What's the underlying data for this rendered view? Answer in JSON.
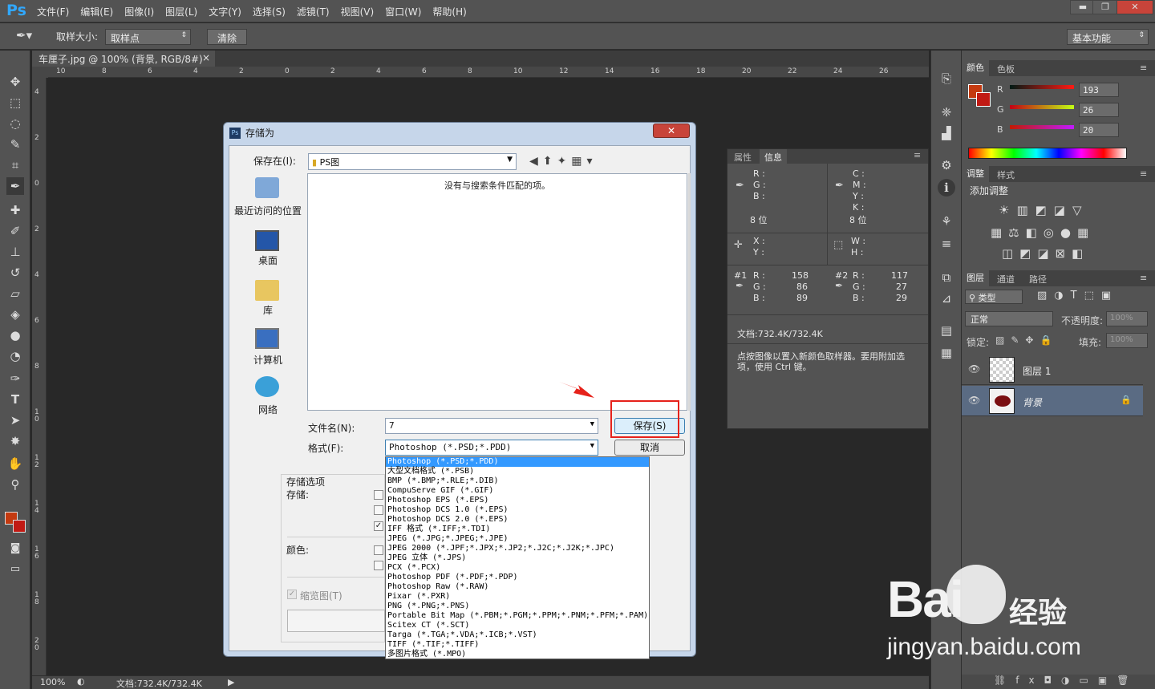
{
  "app": {
    "logo": "Ps",
    "menu": [
      "文件(F)",
      "编辑(E)",
      "图像(I)",
      "图层(L)",
      "文字(Y)",
      "选择(S)",
      "滤镜(T)",
      "视图(V)",
      "窗口(W)",
      "帮助(H)"
    ],
    "window_controls": [
      "▬",
      "❐",
      "✕"
    ]
  },
  "options": {
    "sample_size_label": "取样大小:",
    "sample_size_value": "取样点",
    "clear_label": "清除",
    "workspace": "基本功能"
  },
  "document": {
    "tab_title": "车厘子.jpg @ 100% (背景, RGB/8#) *",
    "tab_close": "×",
    "ruler_h": [
      "10",
      "8",
      "6",
      "4",
      "2",
      "0",
      "2",
      "4",
      "6",
      "8",
      "10",
      "12",
      "14",
      "16",
      "18",
      "20",
      "22",
      "24",
      "26"
    ],
    "ruler_v": [
      "4",
      "2",
      "0",
      "2",
      "4",
      "6",
      "8",
      "1 0",
      "1 2",
      "1 4",
      "1 6",
      "1 8",
      "2 0"
    ],
    "zoom": "100%",
    "doc_size": "文档:732.4K/732.4K"
  },
  "info_panel": {
    "tabs": [
      "属性",
      "信息"
    ],
    "rgb_labels": [
      "R :",
      "G :",
      "B :"
    ],
    "cmyk_labels": [
      "C :",
      "M :",
      "Y :",
      "K :"
    ],
    "bits_left": "8 位",
    "bits_right": "8 位",
    "xy_labels": [
      "X :",
      "Y :"
    ],
    "wh_labels": [
      "W :",
      "H :"
    ],
    "sample1_label": "#1",
    "sample1": {
      "R": "158",
      "G": "86",
      "B": "89"
    },
    "sample2_label": "#2",
    "sample2": {
      "R": "117",
      "G": "27",
      "B": "29"
    },
    "doc": "文档:732.4K/732.4K",
    "hint": "点按图像以置入新颜色取样器。要用附加选项，使用 Ctrl 键。"
  },
  "color_panel": {
    "tabs": [
      "颜色",
      "色板"
    ],
    "labels": [
      "R",
      "G",
      "B"
    ],
    "values": [
      "193",
      "26",
      "20"
    ],
    "fg_color": "#c11a14"
  },
  "adjust_panel": {
    "tabs": [
      "调整",
      "样式"
    ],
    "title": "添加调整"
  },
  "layers_panel": {
    "tabs": [
      "图层",
      "通道",
      "路径"
    ],
    "filter": "类型",
    "blend": "正常",
    "opacity_label": "不透明度:",
    "opacity": "100%",
    "lock_label": "锁定:",
    "fill_label": "填充:",
    "fill": "100%",
    "layers": [
      "图层 1",
      "背景"
    ]
  },
  "dialog": {
    "title": "存储为",
    "close": "✕",
    "save_in_label": "保存在(I):",
    "folder": "PS图",
    "empty_msg": "没有与搜索条件匹配的项。",
    "places": [
      "最近访问的位置",
      "桌面",
      "库",
      "计算机",
      "网络"
    ],
    "filename_label": "文件名(N):",
    "filename": "7",
    "format_label": "格式(F):",
    "format_value": "Photoshop (*.PSD;*.PDD)",
    "save_button": "保存(S)",
    "cancel_button": "取消",
    "options_title": "存储选项",
    "save_label": "存储:",
    "color_label": "颜色:",
    "thumbnail_label": "缩览图(T)",
    "formats": [
      "Photoshop (*.PSD;*.PDD)",
      "大型文档格式 (*.PSB)",
      "BMP (*.BMP;*.RLE;*.DIB)",
      "CompuServe GIF (*.GIF)",
      "Photoshop EPS (*.EPS)",
      "Photoshop DCS 1.0 (*.EPS)",
      "Photoshop DCS 2.0 (*.EPS)",
      "IFF 格式 (*.IFF;*.TDI)",
      "JPEG (*.JPG;*.JPEG;*.JPE)",
      "JPEG 2000 (*.JPF;*.JPX;*.JP2;*.J2C;*.J2K;*.JPC)",
      "JPEG 立体 (*.JPS)",
      "PCX (*.PCX)",
      "Photoshop PDF (*.PDF;*.PDP)",
      "Photoshop Raw (*.RAW)",
      "Pixar (*.PXR)",
      "PNG (*.PNG;*.PNS)",
      "Portable Bit Map (*.PBM;*.PGM;*.PPM;*.PNM;*.PFM;*.PAM)",
      "Scitex CT (*.SCT)",
      "Targa (*.TGA;*.VDA;*.ICB;*.VST)",
      "TIFF (*.TIF;*.TIFF)",
      "多图片格式 (*.MPO)"
    ]
  },
  "watermark": {
    "brand": "Bai",
    "brand_cn": "经验",
    "url": "jingyan.baidu.com"
  }
}
